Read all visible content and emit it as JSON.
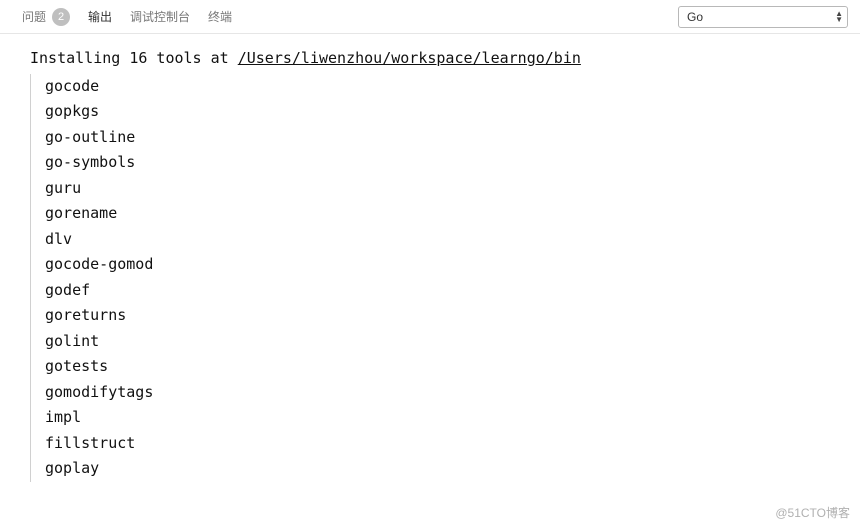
{
  "header": {
    "tabs": {
      "problems": {
        "label": "问题",
        "badge": "2"
      },
      "output": {
        "label": "输出"
      },
      "debug": {
        "label": "调试控制台"
      },
      "terminal": {
        "label": "终端"
      }
    },
    "select": {
      "value": "Go"
    }
  },
  "output": {
    "install_prefix": "Installing 16 tools at ",
    "install_path": "/Users/liwenzhou/workspace/learngo/bin",
    "tools": [
      "gocode",
      "gopkgs",
      "go-outline",
      "go-symbols",
      "guru",
      "gorename",
      "dlv",
      "gocode-gomod",
      "godef",
      "goreturns",
      "golint",
      "gotests",
      "gomodifytags",
      "impl",
      "fillstruct",
      "goplay"
    ]
  },
  "watermark": "@51CTO博客"
}
